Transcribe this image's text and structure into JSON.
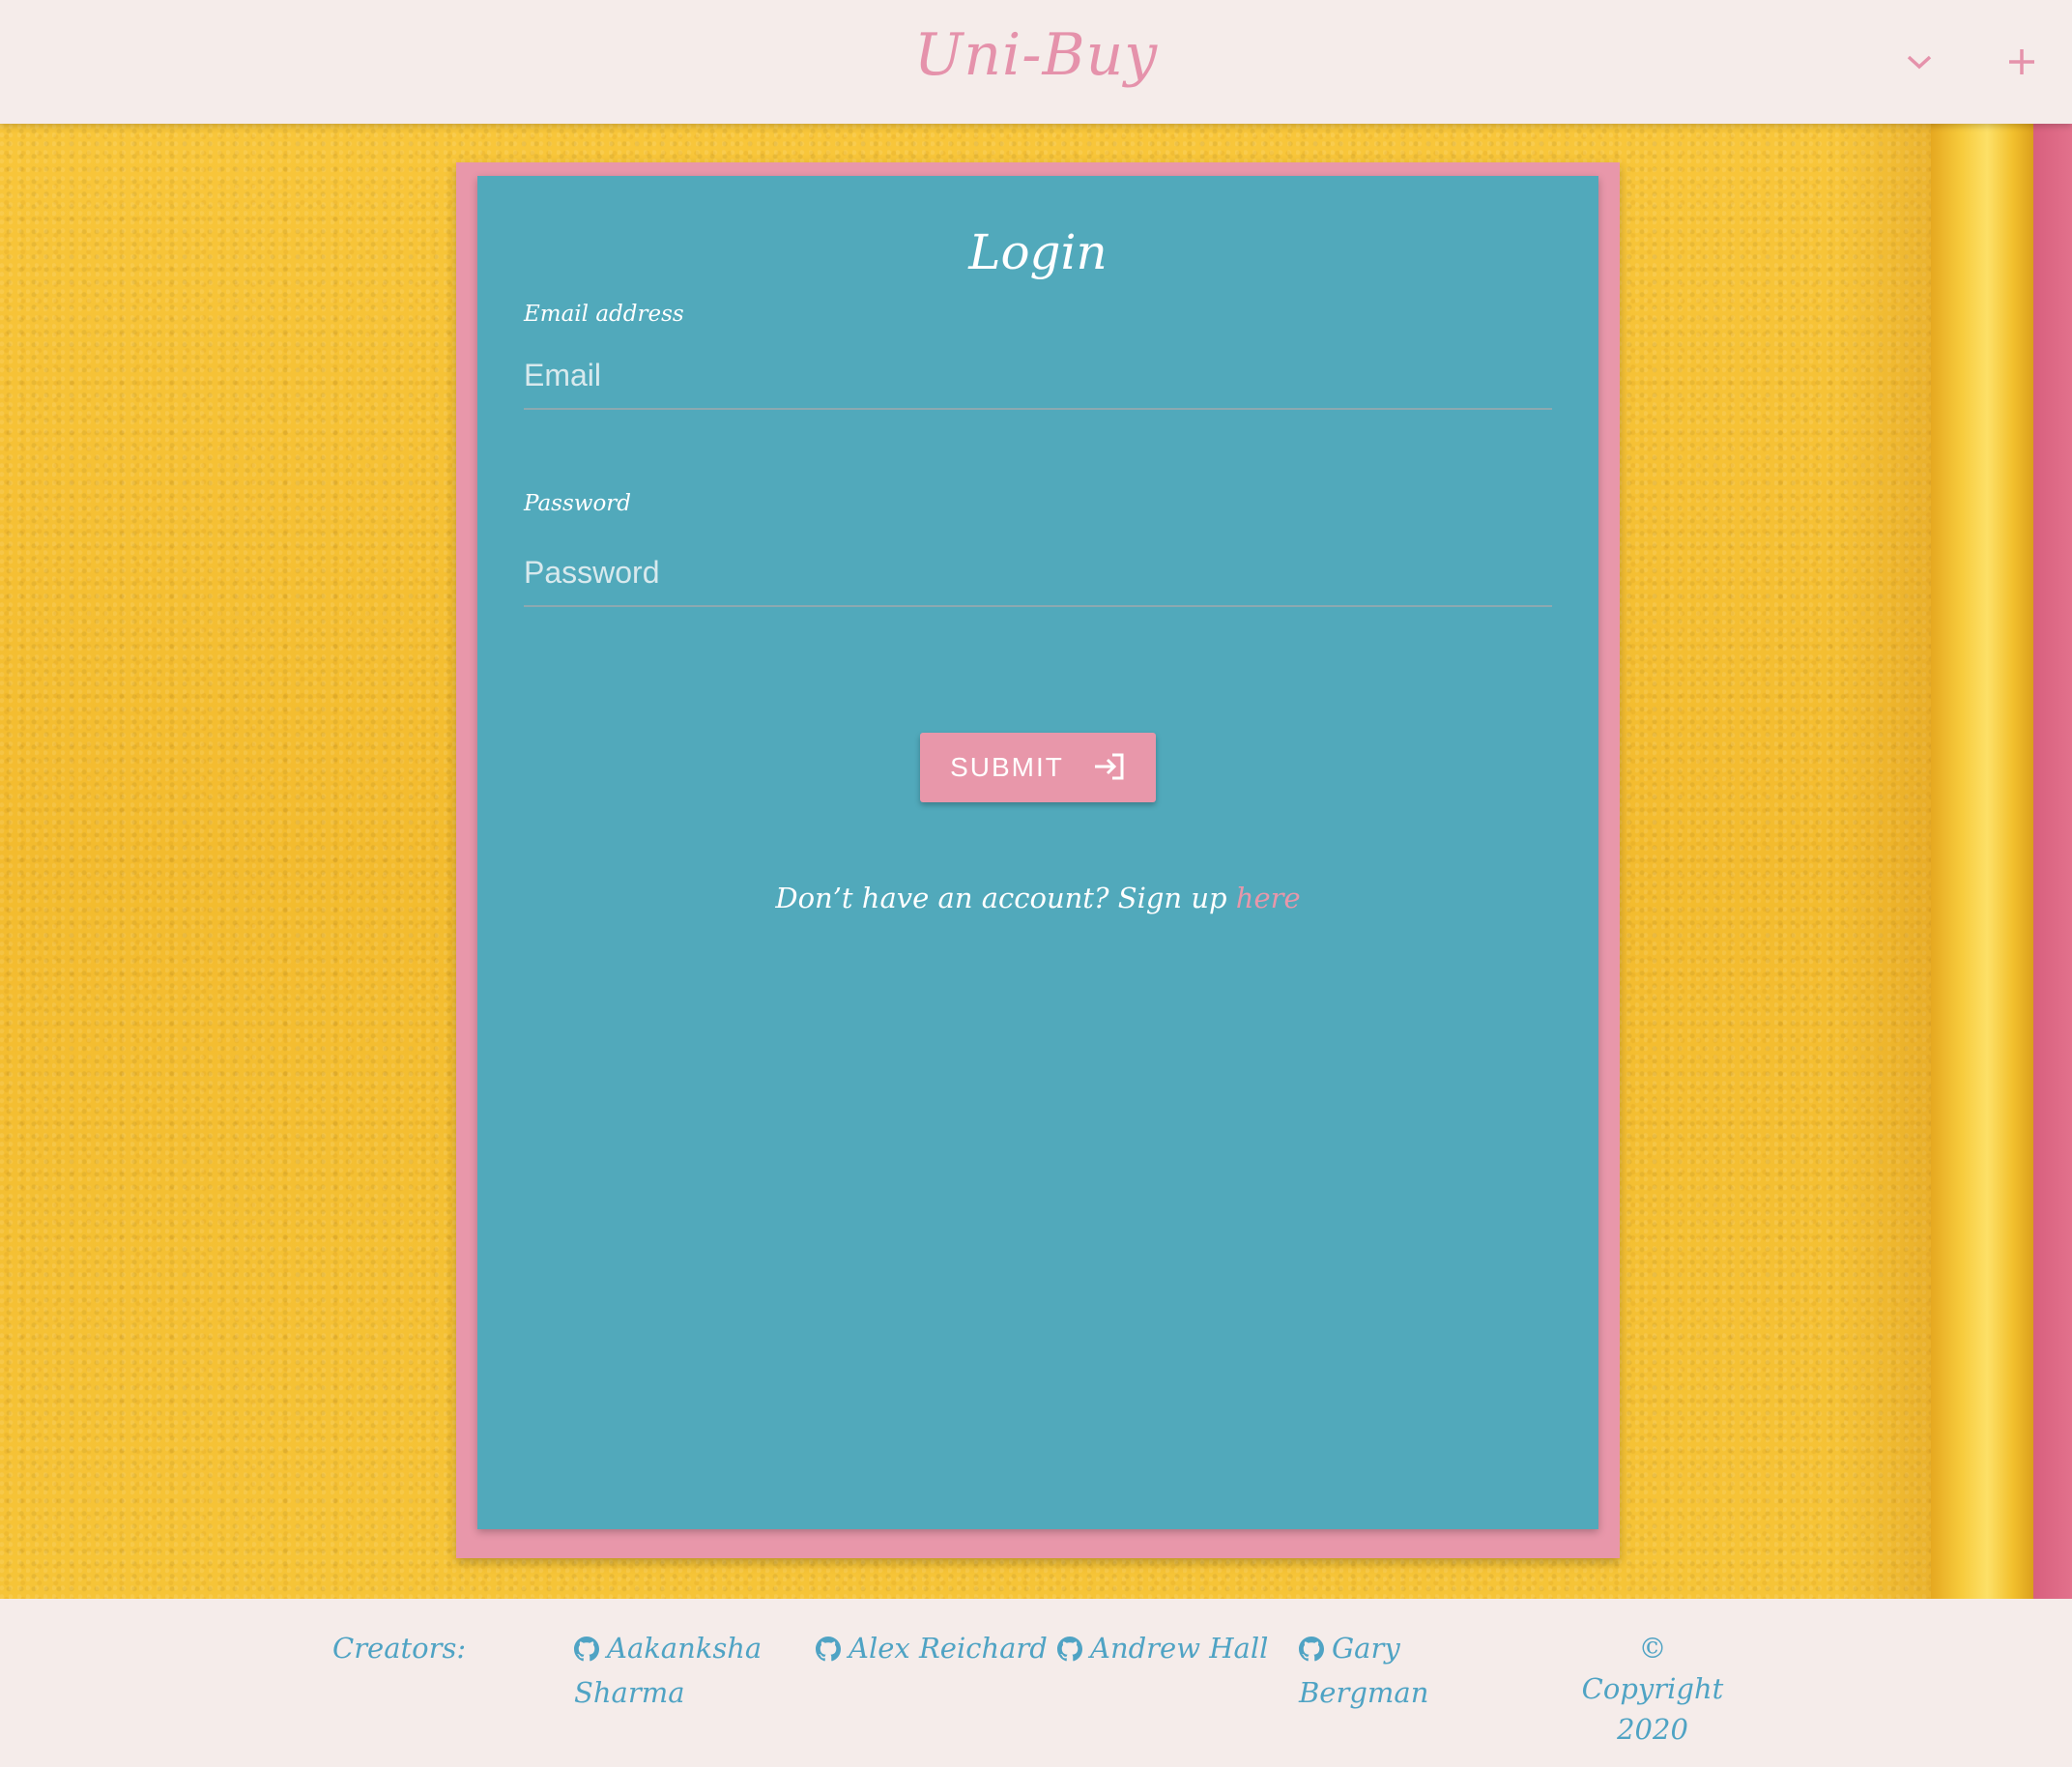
{
  "header": {
    "brand": "Uni-Buy",
    "icons": [
      "chevron-down-icon",
      "plus-icon"
    ]
  },
  "login": {
    "title": "Login",
    "email_label": "Email address",
    "email_placeholder": "Email",
    "email_value": "",
    "password_label": "Password",
    "password_placeholder": "Password",
    "password_value": "",
    "submit_label": "SUBMIT",
    "submit_icon": "login-icon",
    "signup_prompt": "Don’t have an account? Sign up",
    "signup_link": "here"
  },
  "footer": {
    "creators_label": "Creators:",
    "creators": [
      {
        "name": "Aakanksha Sharma",
        "icon": "github-icon"
      },
      {
        "name": "Alex Reichard",
        "icon": "github-icon"
      },
      {
        "name": "Andrew Hall",
        "icon": "github-icon"
      },
      {
        "name": "Gary Bergman",
        "icon": "github-icon"
      }
    ],
    "copyright": "© Copyright 2020"
  },
  "colors": {
    "accent_pink": "#e897aa",
    "card_teal": "#51a9bb",
    "wall_yellow": "#f6c136",
    "footer_link": "#4fa3c4",
    "header_bg": "#f5ecea"
  }
}
